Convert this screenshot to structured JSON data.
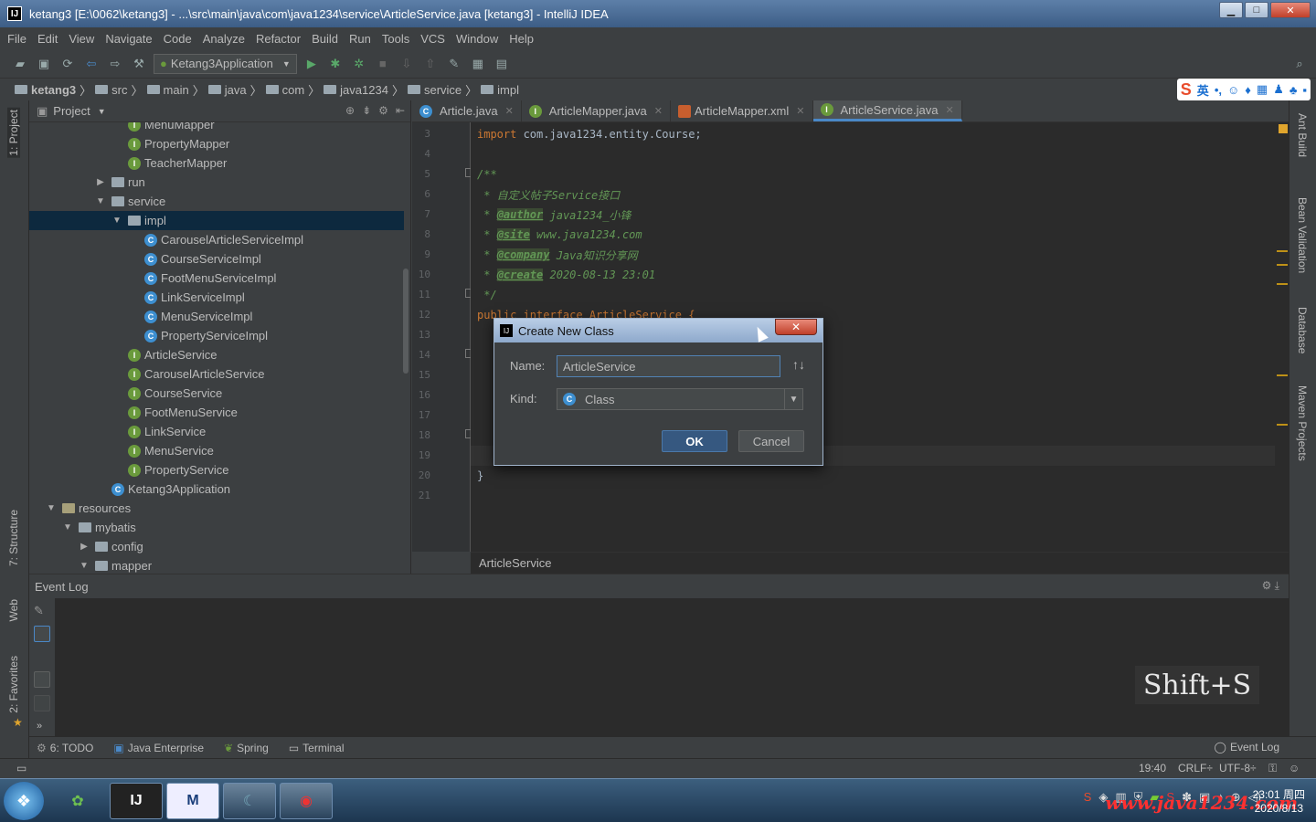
{
  "window": {
    "title": "ketang3 [E:\\0062\\ketang3] - ...\\src\\main\\java\\com\\java1234\\service\\ArticleService.java [ketang3] - IntelliJ IDEA",
    "min": "▁",
    "max": "□",
    "close": "✕"
  },
  "menu": [
    "File",
    "Edit",
    "View",
    "Navigate",
    "Code",
    "Analyze",
    "Refactor",
    "Build",
    "Run",
    "Tools",
    "VCS",
    "Window",
    "Help"
  ],
  "toolbar": {
    "run_config": "Ketang3Application"
  },
  "breadcrumbs": [
    "ketang3",
    "src",
    "main",
    "java",
    "com",
    "java1234",
    "service",
    "impl"
  ],
  "ime": {
    "lang": "英"
  },
  "left_strip": {
    "project": "1: Project",
    "structure": "7: Structure",
    "web": "Web",
    "favorites": "2: Favorites"
  },
  "right_strip": {
    "ant": "Ant Build",
    "bean": "Bean Validation",
    "database": "Database",
    "maven": "Maven Projects"
  },
  "project_panel": {
    "title": "Project"
  },
  "tree": [
    {
      "label": "MenuMapper",
      "type": "i",
      "depth": 7
    },
    {
      "label": "PropertyMapper",
      "type": "i",
      "depth": 7
    },
    {
      "label": "TeacherMapper",
      "type": "i",
      "depth": 7
    },
    {
      "label": "run",
      "type": "folder",
      "depth": 6,
      "arrow": "▶"
    },
    {
      "label": "service",
      "type": "folder",
      "depth": 6,
      "arrow": "▼"
    },
    {
      "label": "impl",
      "type": "folder",
      "depth": 7,
      "arrow": "▼",
      "selected": true
    },
    {
      "label": "CarouselArticleServiceImpl",
      "type": "c",
      "depth": 8
    },
    {
      "label": "CourseServiceImpl",
      "type": "c",
      "depth": 8
    },
    {
      "label": "FootMenuServiceImpl",
      "type": "c",
      "depth": 8
    },
    {
      "label": "LinkServiceImpl",
      "type": "c",
      "depth": 8
    },
    {
      "label": "MenuServiceImpl",
      "type": "c",
      "depth": 8
    },
    {
      "label": "PropertyServiceImpl",
      "type": "c",
      "depth": 8
    },
    {
      "label": "ArticleService",
      "type": "i",
      "depth": 7
    },
    {
      "label": "CarouselArticleService",
      "type": "i",
      "depth": 7
    },
    {
      "label": "CourseService",
      "type": "i",
      "depth": 7
    },
    {
      "label": "FootMenuService",
      "type": "i",
      "depth": 7
    },
    {
      "label": "LinkService",
      "type": "i",
      "depth": 7
    },
    {
      "label": "MenuService",
      "type": "i",
      "depth": 7
    },
    {
      "label": "PropertyService",
      "type": "i",
      "depth": 7
    },
    {
      "label": "Ketang3Application",
      "type": "c",
      "depth": 6
    },
    {
      "label": "resources",
      "type": "res",
      "depth": 3,
      "arrow": "▼"
    },
    {
      "label": "mybatis",
      "type": "folder",
      "depth": 4,
      "arrow": "▼"
    },
    {
      "label": "config",
      "type": "folder",
      "depth": 5,
      "arrow": "▶"
    },
    {
      "label": "mapper",
      "type": "folder",
      "depth": 5,
      "arrow": "▼"
    }
  ],
  "tabs": [
    {
      "label": "Article.java",
      "icon": "c"
    },
    {
      "label": "ArticleMapper.java",
      "icon": "i"
    },
    {
      "label": "ArticleMapper.xml",
      "icon": "x"
    },
    {
      "label": "ArticleService.java",
      "icon": "i",
      "active": true
    }
  ],
  "line_numbers": [
    "3",
    "4",
    "5",
    "6",
    "7",
    "8",
    "9",
    "10",
    "11",
    "12",
    "13",
    "14",
    "15",
    "16",
    "17",
    "18",
    "19",
    "20",
    "21"
  ],
  "code": {
    "l3_kw": "import",
    "l3_rest": " com.java1234.entity.Course;",
    "l5": "/**",
    "l6": " * 自定义帖子Service接口",
    "l7_tag": "@author",
    "l7_rest": " java1234_小锋",
    "l8_tag": "@site",
    "l8_rest": " www.java1234.com",
    "l9_tag": "@company",
    "l9_rest": " Java知识分享网",
    "l10_tag": "@create",
    "l10_rest": " 2020-08-13 23:01",
    "l11": " */",
    "l12": "public interface ArticleService {",
    "l20": "}"
  },
  "editor_breadcrumb": "ArticleService",
  "event_log": {
    "title": "Event Log",
    "shortcut": "Shift+S"
  },
  "tool_windows": [
    "6: TODO",
    "Java Enterprise",
    "Spring",
    "Terminal"
  ],
  "tool_right": "Event Log",
  "status": {
    "position": "19:40",
    "line_sep": "CRLF÷",
    "encoding": "UTF-8÷"
  },
  "dialog": {
    "title": "Create New Class",
    "name_label": "Name:",
    "name_value": "ArticleService",
    "kind_label": "Kind:",
    "kind_value": "Class",
    "ok": "OK",
    "cancel": "Cancel",
    "close": "✕"
  },
  "taskbar": {
    "clock_time": "23:01 周四",
    "clock_date": "2020/8/13",
    "watermark": "www.java1234.com"
  }
}
